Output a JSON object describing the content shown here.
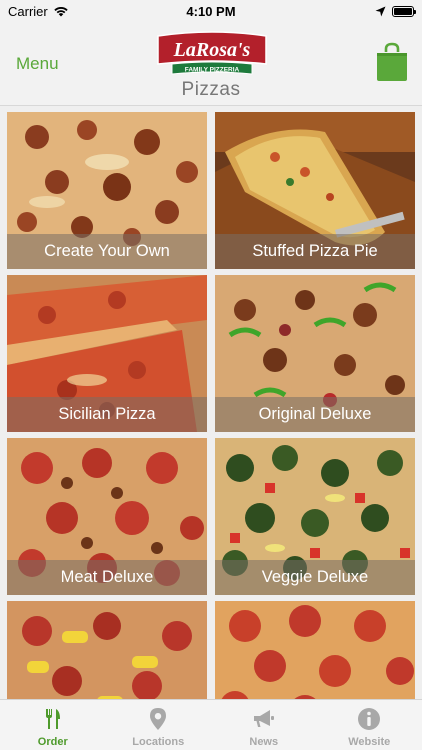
{
  "status_bar": {
    "carrier": "Carrier",
    "time": "4:10 PM"
  },
  "header": {
    "menu_label": "Menu",
    "logo_text": "LaRosa's",
    "logo_subtext": "FAMILY PIZZERIA",
    "title": "Pizzas"
  },
  "colors": {
    "accent": "#5aa83a",
    "brand_red": "#b3202b",
    "brand_green": "#1e7a3c"
  },
  "tiles": [
    {
      "label": "Create Your Own"
    },
    {
      "label": "Stuffed Pizza Pie"
    },
    {
      "label": "Sicilian Pizza"
    },
    {
      "label": "Original Deluxe"
    },
    {
      "label": "Meat Deluxe"
    },
    {
      "label": "Veggie Deluxe"
    },
    {
      "label": ""
    },
    {
      "label": ""
    }
  ],
  "tabs": [
    {
      "label": "Order",
      "icon": "fork-knife-icon",
      "active": true
    },
    {
      "label": "Locations",
      "icon": "location-pin-icon",
      "active": false
    },
    {
      "label": "News",
      "icon": "megaphone-icon",
      "active": false
    },
    {
      "label": "Website",
      "icon": "info-icon",
      "active": false
    }
  ]
}
